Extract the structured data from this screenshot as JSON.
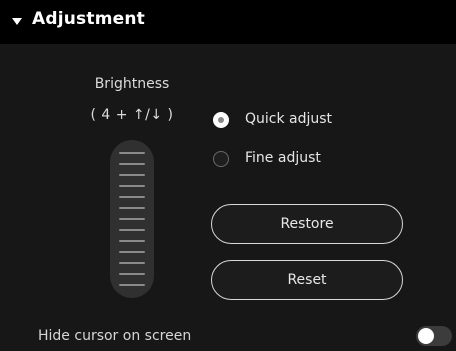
{
  "section": {
    "title": "Adjustment",
    "collapse_icon": "caret-down-icon"
  },
  "brightness": {
    "label": "Brightness",
    "hint": "( 4 + ↑/↓ )",
    "tick_count": 13
  },
  "adjust_mode": {
    "options": [
      {
        "label": "Quick adjust",
        "checked": true
      },
      {
        "label": "Fine adjust",
        "checked": false
      }
    ]
  },
  "buttons": {
    "restore_label": "Restore",
    "reset_label": "Reset"
  },
  "hide_cursor": {
    "label": "Hide cursor on screen",
    "enabled": false
  },
  "colors": {
    "background": "#000000",
    "panel": "#171717",
    "accent": "#ffffff"
  }
}
